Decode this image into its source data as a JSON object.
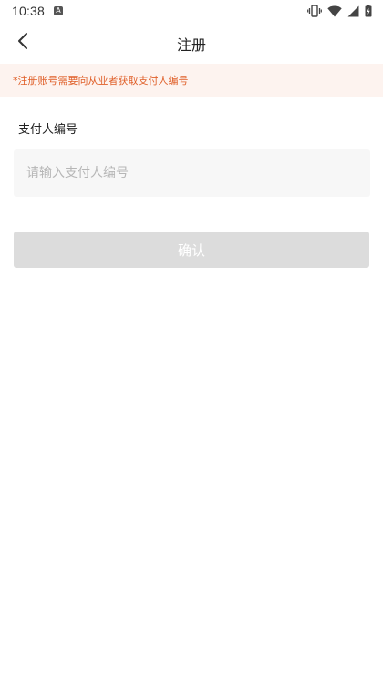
{
  "status_bar": {
    "time": "10:38",
    "notification_icon": "a-notification-icon",
    "icons": [
      "vibrate-icon",
      "wifi-icon",
      "cellular-signal-icon",
      "battery-icon"
    ]
  },
  "header": {
    "title": "注册",
    "back_icon": "chevron-left-icon"
  },
  "notice": {
    "text": "*注册账号需要向从业者获取支付人编号",
    "color": "#e0602a",
    "background": "#fdf3ef"
  },
  "form": {
    "payer_id_label": "支付人编号",
    "payer_id_placeholder": "请输入支付人编号",
    "payer_id_value": ""
  },
  "actions": {
    "confirm_label": "确认",
    "confirm_enabled": false,
    "confirm_color": "#dcdcdc"
  }
}
